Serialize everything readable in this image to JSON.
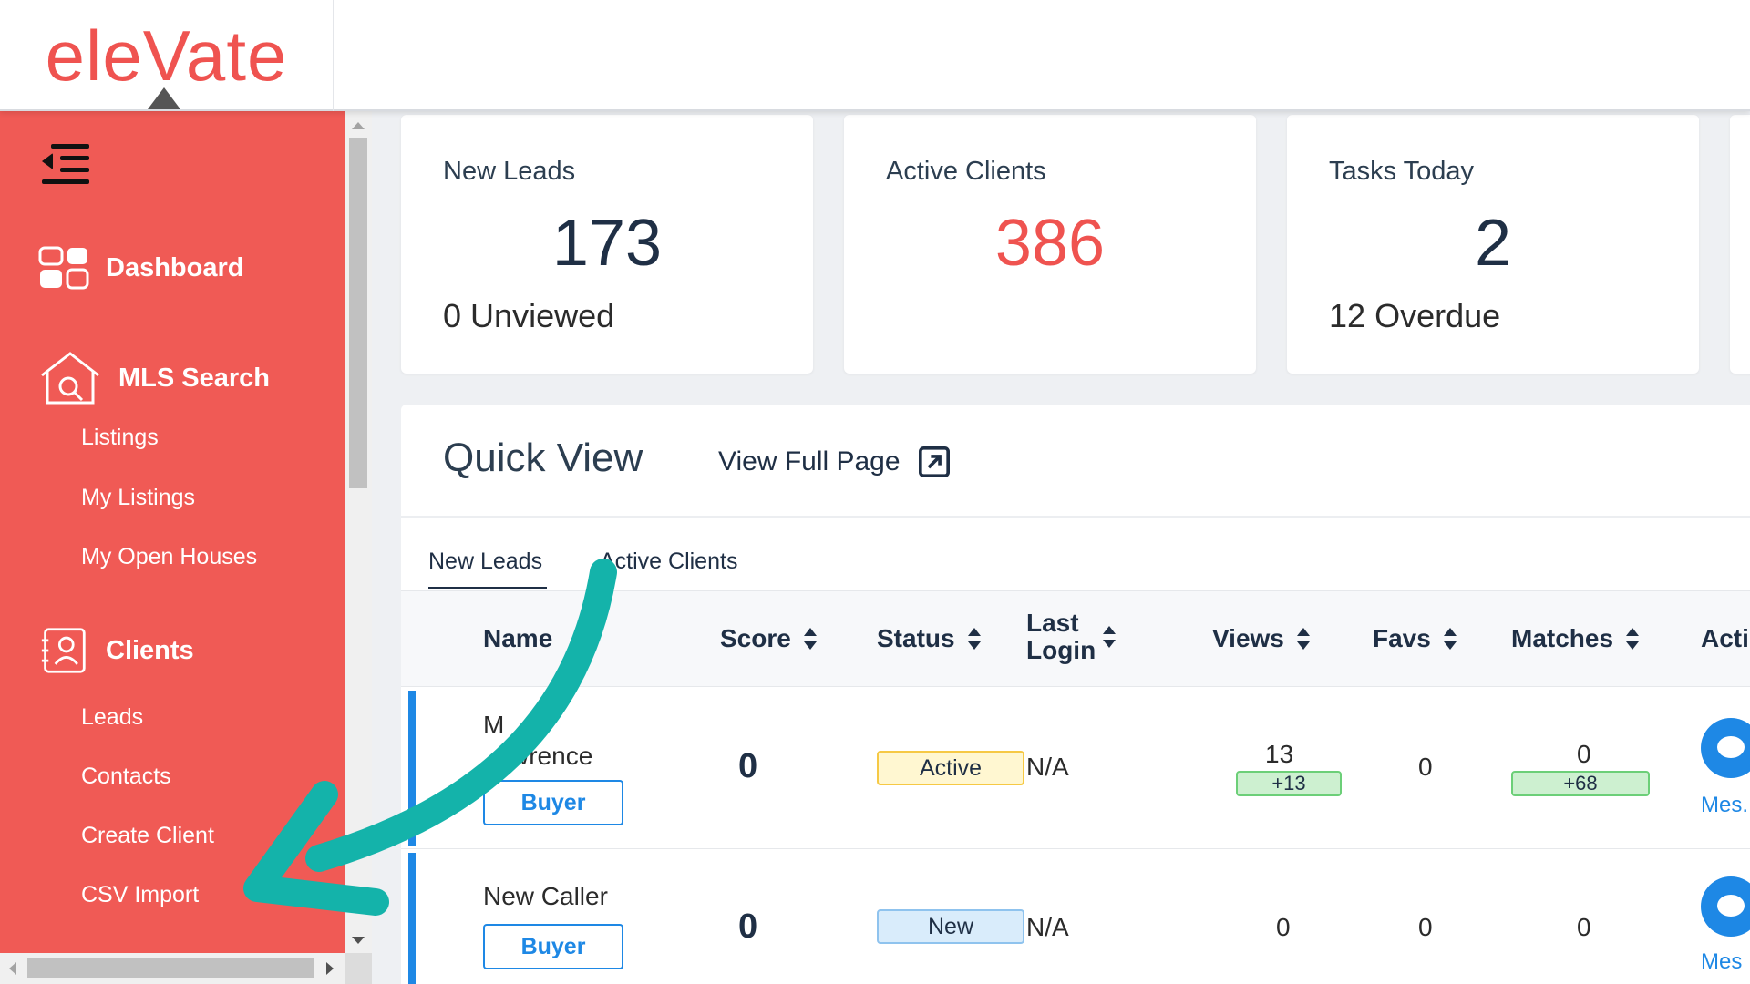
{
  "brand": {
    "logo_text": "eleVate",
    "accent": "#ef5350",
    "sidebar_bg": "#f05a55"
  },
  "sidebar": {
    "toggle_icon": "menu-collapse-icon",
    "sections": [
      {
        "label": "Dashboard",
        "icon": "dashboard-icon"
      },
      {
        "label": "MLS Search",
        "icon": "house-search-icon",
        "items": [
          "Listings",
          "My Listings",
          "My Open Houses"
        ]
      },
      {
        "label": "Clients",
        "icon": "clients-icon",
        "items": [
          "Leads",
          "Contacts",
          "Create Client",
          "CSV Import"
        ]
      }
    ]
  },
  "stats": [
    {
      "title": "New Leads",
      "value": "173",
      "sub_count": "0",
      "sub_label": "Unviewed"
    },
    {
      "title": "Active Clients",
      "value": "386"
    },
    {
      "title": "Tasks Today",
      "value": "2",
      "sub_count": "12",
      "sub_label": "Overdue"
    }
  ],
  "quick_view": {
    "title": "Quick View",
    "link_label": "View Full Page",
    "tabs": [
      "New Leads",
      "Active Clients"
    ],
    "columns": [
      "Name",
      "Score",
      "Status",
      "Last Login",
      "Views",
      "Favs",
      "Matches",
      "Acti"
    ],
    "rows": [
      {
        "name_line1": "M",
        "name_line2": "wrence",
        "type": "Buyer",
        "score": "0",
        "status": "Active",
        "last_login": "N/A",
        "views": "13",
        "views_delta": "+13",
        "favs": "0",
        "matches": "0",
        "matches_delta": "+68",
        "action": "Mes."
      },
      {
        "name": "New Caller",
        "type": "Buyer",
        "score": "0",
        "status": "New",
        "last_login": "N/A",
        "views": "0",
        "favs": "0",
        "matches": "0",
        "action": "Mes"
      }
    ]
  }
}
